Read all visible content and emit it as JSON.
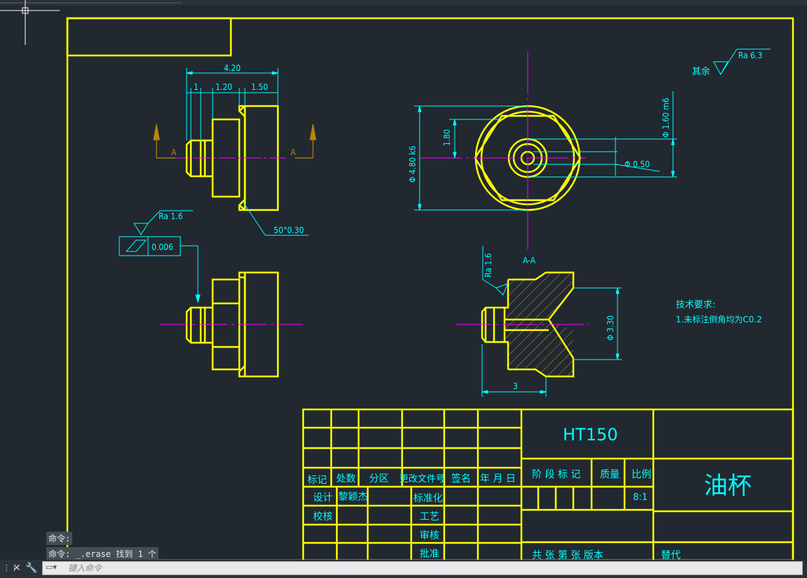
{
  "drawing": {
    "title_block": {
      "material": "HT150",
      "part_name": "油杯",
      "headers": [
        "标记",
        "处数",
        "分区",
        "更改文件号",
        "签名",
        "年 月 日"
      ],
      "stage_label": "阶 段 标 记",
      "mass_label": "质量",
      "scale_label": "比例",
      "scale_value": "8:1",
      "design_label": "设计",
      "designer": "黎颖杰",
      "check_label": "校核",
      "std_label": "标准化",
      "process_label": "工艺",
      "review_label": "审核",
      "approve_label": "批准",
      "sheets_label": "共  张 第  张 版本",
      "replace_label": "替代"
    },
    "dimensions": {
      "total_len": "4.20",
      "len_1": "1",
      "len_2": "1.20",
      "len_3": "1.50",
      "chamfer": "50°0.30",
      "dia_outer": "Φ 4.80 k6",
      "flat": "1.80",
      "dia_shank": "Φ 1.60 m6",
      "dia_hole": "Φ 0.50",
      "dia_bore": "Φ 3.30",
      "section_len": "3",
      "section_label_left": "A",
      "section_label_right": "A",
      "section_title": "A-A",
      "ra_main": "Ra  1.6",
      "ra_section": "Ra  1.6",
      "ra_other": "Ra  6.3",
      "other_label": "其余",
      "tolerance_value": "0.006"
    },
    "tech": {
      "title": "技术要求:",
      "line1": "1.未标注倒角均为C0.2"
    }
  },
  "command": {
    "history": [
      "命令:",
      "命令: _.erase 找到 1 个"
    ],
    "placeholder": "键入命令"
  },
  "colors": {
    "background": "#212830",
    "outline": "#ffff00",
    "dimension": "#00ffff",
    "centerline": "#ff00ff",
    "hatch": "#d4a017",
    "arrow": "#b8860b"
  }
}
